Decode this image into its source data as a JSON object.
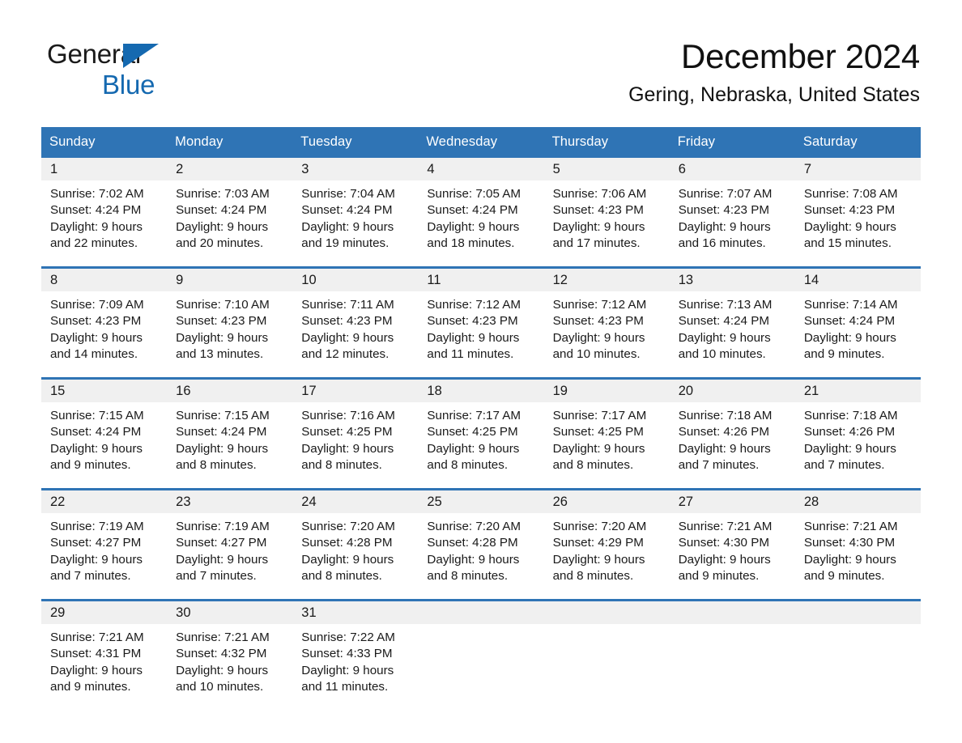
{
  "brand": {
    "word1": "General",
    "word2": "Blue",
    "triangle_color": "#1569b0"
  },
  "header": {
    "month_title": "December 2024",
    "location": "Gering, Nebraska, United States"
  },
  "theme": {
    "header_blue": "#2f74b5",
    "day_band_gray": "#f0f0f0",
    "text_dark": "#1a1a1a"
  },
  "weekdays": [
    "Sunday",
    "Monday",
    "Tuesday",
    "Wednesday",
    "Thursday",
    "Friday",
    "Saturday"
  ],
  "weeks": [
    [
      {
        "day": "1",
        "sunrise": "Sunrise: 7:02 AM",
        "sunset": "Sunset: 4:24 PM",
        "daylight1": "Daylight: 9 hours",
        "daylight2": "and 22 minutes."
      },
      {
        "day": "2",
        "sunrise": "Sunrise: 7:03 AM",
        "sunset": "Sunset: 4:24 PM",
        "daylight1": "Daylight: 9 hours",
        "daylight2": "and 20 minutes."
      },
      {
        "day": "3",
        "sunrise": "Sunrise: 7:04 AM",
        "sunset": "Sunset: 4:24 PM",
        "daylight1": "Daylight: 9 hours",
        "daylight2": "and 19 minutes."
      },
      {
        "day": "4",
        "sunrise": "Sunrise: 7:05 AM",
        "sunset": "Sunset: 4:24 PM",
        "daylight1": "Daylight: 9 hours",
        "daylight2": "and 18 minutes."
      },
      {
        "day": "5",
        "sunrise": "Sunrise: 7:06 AM",
        "sunset": "Sunset: 4:23 PM",
        "daylight1": "Daylight: 9 hours",
        "daylight2": "and 17 minutes."
      },
      {
        "day": "6",
        "sunrise": "Sunrise: 7:07 AM",
        "sunset": "Sunset: 4:23 PM",
        "daylight1": "Daylight: 9 hours",
        "daylight2": "and 16 minutes."
      },
      {
        "day": "7",
        "sunrise": "Sunrise: 7:08 AM",
        "sunset": "Sunset: 4:23 PM",
        "daylight1": "Daylight: 9 hours",
        "daylight2": "and 15 minutes."
      }
    ],
    [
      {
        "day": "8",
        "sunrise": "Sunrise: 7:09 AM",
        "sunset": "Sunset: 4:23 PM",
        "daylight1": "Daylight: 9 hours",
        "daylight2": "and 14 minutes."
      },
      {
        "day": "9",
        "sunrise": "Sunrise: 7:10 AM",
        "sunset": "Sunset: 4:23 PM",
        "daylight1": "Daylight: 9 hours",
        "daylight2": "and 13 minutes."
      },
      {
        "day": "10",
        "sunrise": "Sunrise: 7:11 AM",
        "sunset": "Sunset: 4:23 PM",
        "daylight1": "Daylight: 9 hours",
        "daylight2": "and 12 minutes."
      },
      {
        "day": "11",
        "sunrise": "Sunrise: 7:12 AM",
        "sunset": "Sunset: 4:23 PM",
        "daylight1": "Daylight: 9 hours",
        "daylight2": "and 11 minutes."
      },
      {
        "day": "12",
        "sunrise": "Sunrise: 7:12 AM",
        "sunset": "Sunset: 4:23 PM",
        "daylight1": "Daylight: 9 hours",
        "daylight2": "and 10 minutes."
      },
      {
        "day": "13",
        "sunrise": "Sunrise: 7:13 AM",
        "sunset": "Sunset: 4:24 PM",
        "daylight1": "Daylight: 9 hours",
        "daylight2": "and 10 minutes."
      },
      {
        "day": "14",
        "sunrise": "Sunrise: 7:14 AM",
        "sunset": "Sunset: 4:24 PM",
        "daylight1": "Daylight: 9 hours",
        "daylight2": "and 9 minutes."
      }
    ],
    [
      {
        "day": "15",
        "sunrise": "Sunrise: 7:15 AM",
        "sunset": "Sunset: 4:24 PM",
        "daylight1": "Daylight: 9 hours",
        "daylight2": "and 9 minutes."
      },
      {
        "day": "16",
        "sunrise": "Sunrise: 7:15 AM",
        "sunset": "Sunset: 4:24 PM",
        "daylight1": "Daylight: 9 hours",
        "daylight2": "and 8 minutes."
      },
      {
        "day": "17",
        "sunrise": "Sunrise: 7:16 AM",
        "sunset": "Sunset: 4:25 PM",
        "daylight1": "Daylight: 9 hours",
        "daylight2": "and 8 minutes."
      },
      {
        "day": "18",
        "sunrise": "Sunrise: 7:17 AM",
        "sunset": "Sunset: 4:25 PM",
        "daylight1": "Daylight: 9 hours",
        "daylight2": "and 8 minutes."
      },
      {
        "day": "19",
        "sunrise": "Sunrise: 7:17 AM",
        "sunset": "Sunset: 4:25 PM",
        "daylight1": "Daylight: 9 hours",
        "daylight2": "and 8 minutes."
      },
      {
        "day": "20",
        "sunrise": "Sunrise: 7:18 AM",
        "sunset": "Sunset: 4:26 PM",
        "daylight1": "Daylight: 9 hours",
        "daylight2": "and 7 minutes."
      },
      {
        "day": "21",
        "sunrise": "Sunrise: 7:18 AM",
        "sunset": "Sunset: 4:26 PM",
        "daylight1": "Daylight: 9 hours",
        "daylight2": "and 7 minutes."
      }
    ],
    [
      {
        "day": "22",
        "sunrise": "Sunrise: 7:19 AM",
        "sunset": "Sunset: 4:27 PM",
        "daylight1": "Daylight: 9 hours",
        "daylight2": "and 7 minutes."
      },
      {
        "day": "23",
        "sunrise": "Sunrise: 7:19 AM",
        "sunset": "Sunset: 4:27 PM",
        "daylight1": "Daylight: 9 hours",
        "daylight2": "and 7 minutes."
      },
      {
        "day": "24",
        "sunrise": "Sunrise: 7:20 AM",
        "sunset": "Sunset: 4:28 PM",
        "daylight1": "Daylight: 9 hours",
        "daylight2": "and 8 minutes."
      },
      {
        "day": "25",
        "sunrise": "Sunrise: 7:20 AM",
        "sunset": "Sunset: 4:28 PM",
        "daylight1": "Daylight: 9 hours",
        "daylight2": "and 8 minutes."
      },
      {
        "day": "26",
        "sunrise": "Sunrise: 7:20 AM",
        "sunset": "Sunset: 4:29 PM",
        "daylight1": "Daylight: 9 hours",
        "daylight2": "and 8 minutes."
      },
      {
        "day": "27",
        "sunrise": "Sunrise: 7:21 AM",
        "sunset": "Sunset: 4:30 PM",
        "daylight1": "Daylight: 9 hours",
        "daylight2": "and 9 minutes."
      },
      {
        "day": "28",
        "sunrise": "Sunrise: 7:21 AM",
        "sunset": "Sunset: 4:30 PM",
        "daylight1": "Daylight: 9 hours",
        "daylight2": "and 9 minutes."
      }
    ],
    [
      {
        "day": "29",
        "sunrise": "Sunrise: 7:21 AM",
        "sunset": "Sunset: 4:31 PM",
        "daylight1": "Daylight: 9 hours",
        "daylight2": "and 9 minutes."
      },
      {
        "day": "30",
        "sunrise": "Sunrise: 7:21 AM",
        "sunset": "Sunset: 4:32 PM",
        "daylight1": "Daylight: 9 hours",
        "daylight2": "and 10 minutes."
      },
      {
        "day": "31",
        "sunrise": "Sunrise: 7:22 AM",
        "sunset": "Sunset: 4:33 PM",
        "daylight1": "Daylight: 9 hours",
        "daylight2": "and 11 minutes."
      },
      {
        "day": "",
        "sunrise": "",
        "sunset": "",
        "daylight1": "",
        "daylight2": ""
      },
      {
        "day": "",
        "sunrise": "",
        "sunset": "",
        "daylight1": "",
        "daylight2": ""
      },
      {
        "day": "",
        "sunrise": "",
        "sunset": "",
        "daylight1": "",
        "daylight2": ""
      },
      {
        "day": "",
        "sunrise": "",
        "sunset": "",
        "daylight1": "",
        "daylight2": ""
      }
    ]
  ]
}
